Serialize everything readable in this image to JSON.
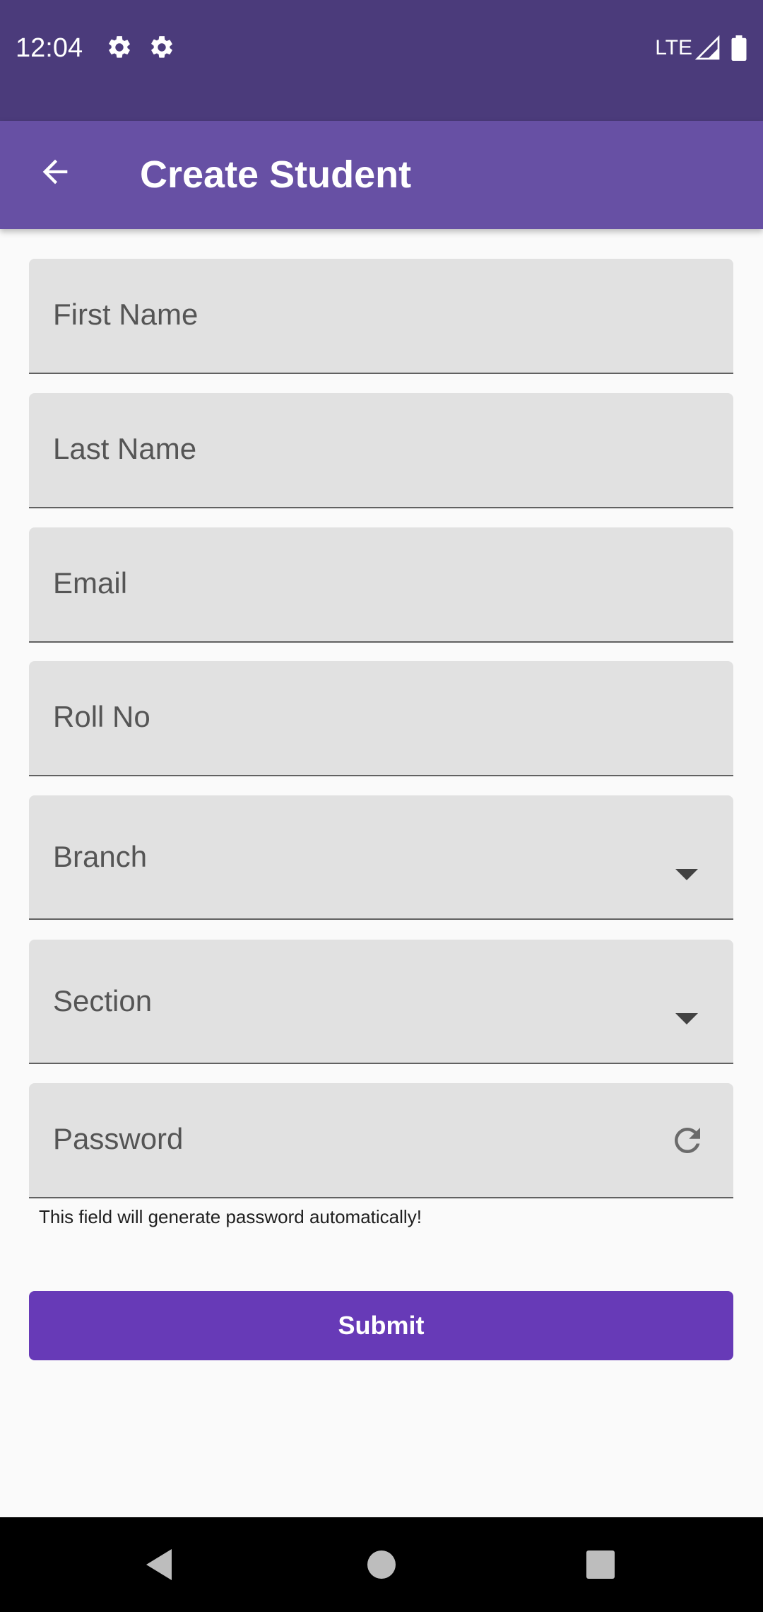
{
  "status_bar": {
    "time": "12:04",
    "network": "LTE",
    "icons": [
      "gear-icon",
      "gear-icon",
      "signal-icon",
      "battery-icon"
    ]
  },
  "app_bar": {
    "title": "Create Student",
    "back_icon": "arrow-back-icon"
  },
  "form": {
    "first_name": {
      "label": "First Name",
      "value": ""
    },
    "last_name": {
      "label": "Last Name",
      "value": ""
    },
    "email": {
      "label": "Email",
      "value": ""
    },
    "roll_no": {
      "label": "Roll No",
      "value": ""
    },
    "branch": {
      "label": "Branch",
      "icon": "dropdown-arrow-icon"
    },
    "section": {
      "label": "Section",
      "icon": "dropdown-arrow-icon"
    },
    "password": {
      "label": "Password",
      "icon": "refresh-icon"
    },
    "password_helper": "This field will generate password automatically!",
    "submit_label": "Submit"
  },
  "nav_bar": {
    "buttons": [
      "back-triangle-icon",
      "home-circle-icon",
      "recents-square-icon"
    ]
  },
  "colors": {
    "status_bar": "#4b3b7b",
    "app_bar": "#6750a4",
    "field_bg": "#e1e1e1",
    "submit_bg": "#673ab7",
    "background": "#fafafa"
  }
}
